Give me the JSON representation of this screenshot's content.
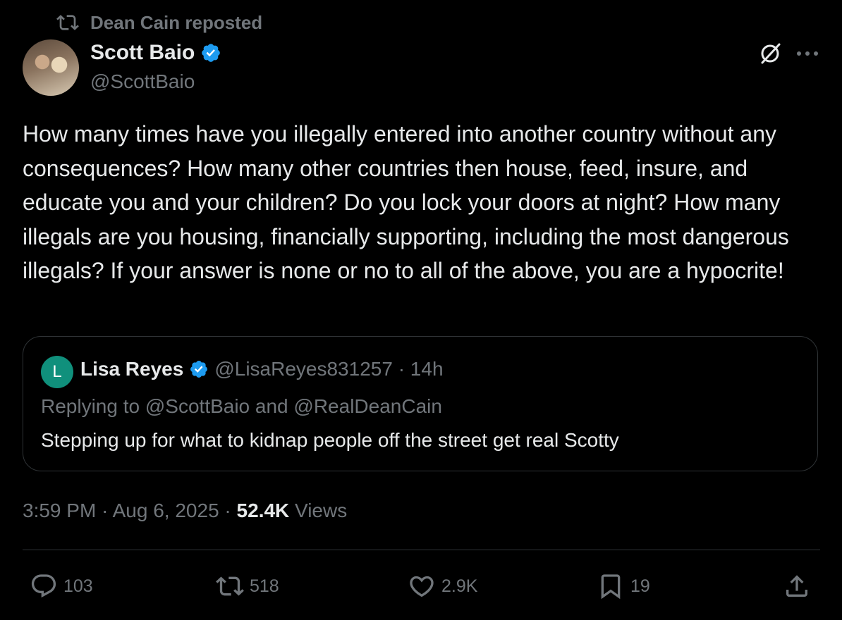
{
  "repost": {
    "label": "Dean Cain reposted"
  },
  "author": {
    "name": "Scott Baio",
    "handle": "@ScottBaio"
  },
  "tweet": {
    "text": "How many times have you illegally entered into another country without any consequences? How many other countries then house, feed, insure, and educate you and your children? Do you lock your doors at night? How many illegals are you housing, financially supporting, including the most dangerous illegals? If your answer is none or no to all of the above, you are a hypocrite!"
  },
  "quote": {
    "avatar_letter": "L",
    "name": "Lisa Reyes",
    "handle_time": "@LisaReyes831257 · 14h",
    "replying_to": "Replying to @ScottBaio and @RealDeanCain",
    "text": "Stepping up for what to kidnap people off the street get real Scotty"
  },
  "meta": {
    "time": "3:59 PM",
    "sep1": " · ",
    "date": "Aug 6, 2025",
    "sep2": " · ",
    "views_count": "52.4K",
    "views_label": " Views"
  },
  "actions": {
    "replies": "103",
    "reposts": "518",
    "likes": "2.9K",
    "bookmarks": "19"
  },
  "colors": {
    "background": "#000000",
    "text": "#e7e9ea",
    "muted": "#71767b",
    "verified": "#1d9bf0",
    "border": "#2f3336"
  }
}
